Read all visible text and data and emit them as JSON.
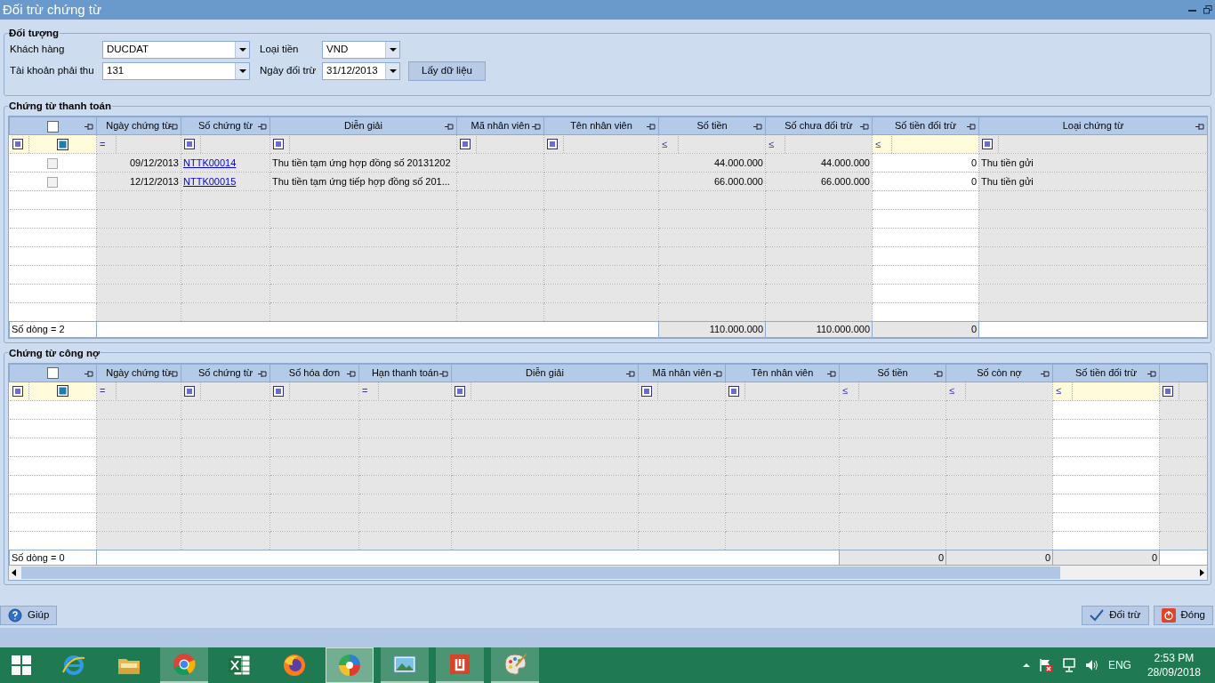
{
  "window": {
    "title": "Đối trừ chứng từ"
  },
  "object_group": {
    "title": "Đối tượng",
    "fields": [
      {
        "label": "Khách hàng",
        "value": "DUCDAT"
      },
      {
        "label": "Loại tiền",
        "value": "VND"
      },
      {
        "label": "Tài khoản phải thu",
        "value": "131"
      },
      {
        "label": "Ngày đối trừ",
        "value": "31/12/2013"
      }
    ],
    "button": "Lấy dữ liệu"
  },
  "payment_grid": {
    "title": "Chứng từ thanh toán",
    "columns": [
      {
        "kind": "check",
        "checked": false,
        "editable": true,
        "filter": {
          "kind": "toggle"
        }
      },
      {
        "label": "Ngày chứng từ",
        "kind": "date",
        "editable": false,
        "filter": {
          "kind": "operator",
          "text": "="
        }
      },
      {
        "label": "Số chứng từ",
        "kind": "link",
        "editable": false,
        "filter": {
          "kind": "box"
        }
      },
      {
        "label": "Diễn giải",
        "kind": "text",
        "editable": false,
        "filter": {
          "kind": "box"
        }
      },
      {
        "label": "Mã nhân viên",
        "kind": "text",
        "editable": false,
        "filter": {
          "kind": "box"
        }
      },
      {
        "label": "Tên nhân viên",
        "kind": "text",
        "editable": false,
        "filter": {
          "kind": "box"
        }
      },
      {
        "label": "Số tiền",
        "kind": "number",
        "editable": false,
        "filter": {
          "kind": "operator",
          "text": "≤"
        },
        "total": "110.000.000"
      },
      {
        "label": "Số chưa đối trừ",
        "kind": "number",
        "editable": false,
        "filter": {
          "kind": "operator",
          "text": "≤"
        },
        "total": "110.000.000"
      },
      {
        "label": "Số tiền đối trừ",
        "kind": "number",
        "editable": true,
        "filter": {
          "kind": "operator",
          "text": "≤"
        },
        "total": "0"
      },
      {
        "label": "Loại chứng từ",
        "kind": "text",
        "editable": false,
        "filter": {
          "kind": "box"
        }
      }
    ],
    "rows": [
      {
        "checked": false,
        "cells": [
          "",
          "09/12/2013",
          "NTTK00014",
          "Thu tiền tạm ứng hợp đồng số 20131202",
          "",
          "",
          "44.000.000",
          "44.000.000",
          "0",
          "Thu tiền gửi"
        ]
      },
      {
        "checked": false,
        "cells": [
          "",
          "12/12/2013",
          "NTTK00015",
          "Thu tiền tạm ứng tiếp hợp đồng số 201...",
          "",
          "",
          "66.000.000",
          "66.000.000",
          "0",
          "Thu tiền gửi"
        ]
      }
    ],
    "row_count": "Số dòng = 2"
  },
  "debt_grid": {
    "title": "Chứng từ công nợ",
    "columns": [
      {
        "kind": "check",
        "checked": false,
        "editable": true,
        "filter": {
          "kind": "toggle"
        }
      },
      {
        "label": "Ngày chứng từ",
        "kind": "date",
        "editable": false,
        "filter": {
          "kind": "operator",
          "text": "="
        }
      },
      {
        "label": "Số chứng từ",
        "kind": "link",
        "editable": false,
        "filter": {
          "kind": "box"
        }
      },
      {
        "label": "Số hóa đơn",
        "kind": "text",
        "editable": false,
        "filter": {
          "kind": "box"
        }
      },
      {
        "label": "Hạn thanh toán",
        "kind": "date",
        "editable": false,
        "filter": {
          "kind": "operator",
          "text": "="
        }
      },
      {
        "label": "Diễn giải",
        "kind": "text",
        "editable": false,
        "filter": {
          "kind": "box"
        }
      },
      {
        "label": "Mã nhân viên",
        "kind": "text",
        "editable": false,
        "filter": {
          "kind": "box"
        }
      },
      {
        "label": "Tên nhân viên",
        "kind": "text",
        "editable": false,
        "filter": {
          "kind": "box"
        }
      },
      {
        "label": "Số tiền",
        "kind": "number",
        "editable": false,
        "filter": {
          "kind": "operator",
          "text": "≤"
        },
        "total": "0"
      },
      {
        "label": "Số còn nợ",
        "kind": "number",
        "editable": false,
        "filter": {
          "kind": "operator",
          "text": "≤"
        },
        "total": "0"
      },
      {
        "label": "Số tiền đối trừ",
        "kind": "number",
        "editable": true,
        "filter": {
          "kind": "operator",
          "text": "≤"
        },
        "total": "0"
      },
      {
        "kind": "text",
        "editable": false,
        "filter": {
          "kind": "box"
        }
      }
    ],
    "row_count": "Số dòng = 0"
  },
  "buttons": {
    "help": "Giúp",
    "offset": "Đối trừ",
    "close": "Đóng"
  },
  "taskbar": {
    "apps": [
      {
        "kind": "ie",
        "running": false,
        "active": false
      },
      {
        "kind": "folder",
        "running": false,
        "active": false
      },
      {
        "kind": "chrome",
        "running": true,
        "active": false
      },
      {
        "kind": "excel",
        "running": false,
        "active": false
      },
      {
        "kind": "firefox",
        "running": false,
        "active": false
      },
      {
        "kind": "pinwheel",
        "running": true,
        "active": true
      },
      {
        "kind": "photo",
        "running": true,
        "active": false
      },
      {
        "kind": "reader",
        "running": true,
        "active": false
      },
      {
        "kind": "paint",
        "running": true,
        "active": false
      }
    ],
    "language": "ENG",
    "time": "2:53 PM",
    "date": "28/09/2018"
  }
}
